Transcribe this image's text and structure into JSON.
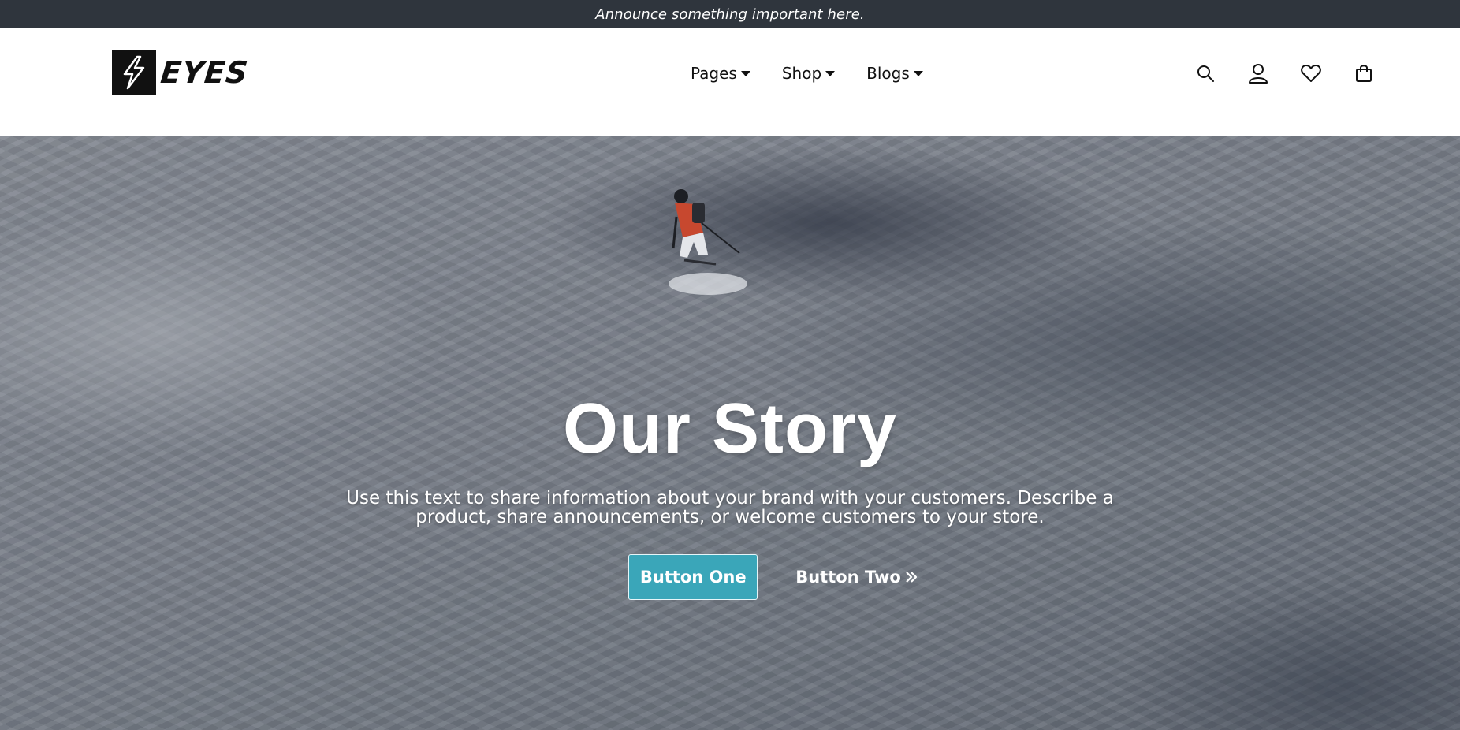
{
  "announcement": {
    "text": "Announce something important here."
  },
  "header": {
    "logo_text": "EYES",
    "nav": [
      {
        "label": "Pages"
      },
      {
        "label": "Shop"
      },
      {
        "label": "Blogs"
      }
    ],
    "icons": [
      "search-icon",
      "account-icon",
      "wishlist-heart-icon",
      "cart-bag-icon"
    ]
  },
  "hero": {
    "title": "Our Story",
    "text": "Use this text to share information about your brand with your customers. Describe a product, share announcements, or welcome customers to your store.",
    "button_one": "Button One",
    "button_two": "Button Two"
  },
  "colors": {
    "announcement_bg": "#2f353d",
    "accent": "#3aa6b9",
    "header_bg": "#ffffff"
  }
}
